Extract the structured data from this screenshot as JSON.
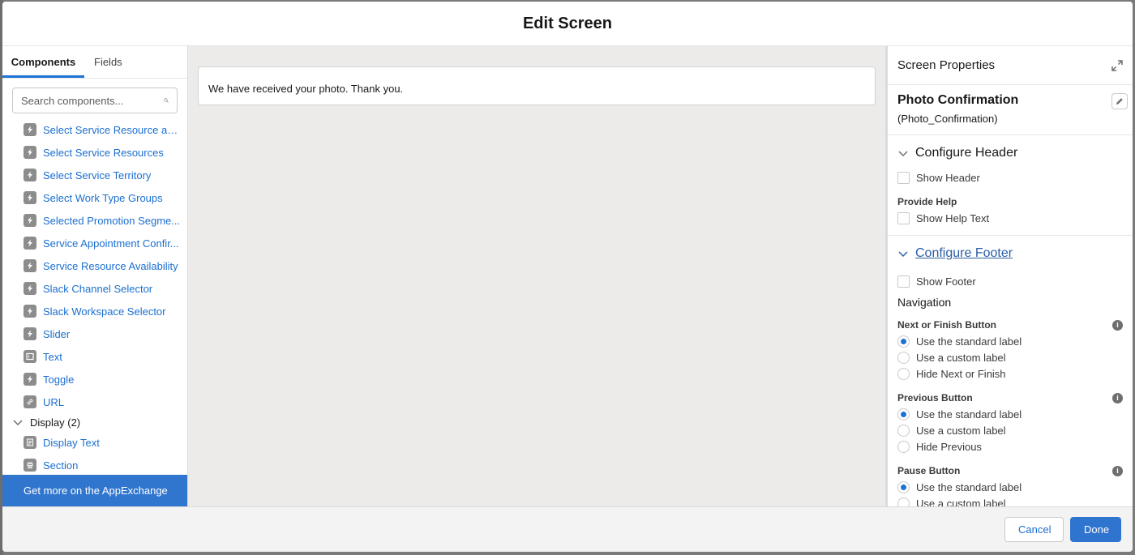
{
  "modal": {
    "title": "Edit Screen"
  },
  "left_panel": {
    "tabs": [
      {
        "label": "Components",
        "active": true
      },
      {
        "label": "Fields",
        "active": false
      }
    ],
    "search": {
      "placeholder": "Search components...",
      "value": ""
    },
    "components": [
      {
        "label": "Select Service Resource an...",
        "icon": "lightning-icon"
      },
      {
        "label": "Select Service Resources",
        "icon": "lightning-icon"
      },
      {
        "label": "Select Service Territory",
        "icon": "lightning-icon"
      },
      {
        "label": "Select Work Type Groups",
        "icon": "lightning-icon"
      },
      {
        "label": "Selected Promotion Segme...",
        "icon": "lightning-icon"
      },
      {
        "label": "Service Appointment Confir...",
        "icon": "lightning-icon"
      },
      {
        "label": "Service Resource Availability",
        "icon": "lightning-icon"
      },
      {
        "label": "Slack Channel Selector",
        "icon": "lightning-icon"
      },
      {
        "label": "Slack Workspace Selector",
        "icon": "lightning-icon"
      },
      {
        "label": "Slider",
        "icon": "lightning-icon"
      },
      {
        "label": "Text",
        "icon": "text-input-icon"
      },
      {
        "label": "Toggle",
        "icon": "lightning-icon"
      },
      {
        "label": "URL",
        "icon": "link-icon"
      }
    ],
    "display_section": {
      "label": "Display (2)",
      "items": [
        {
          "label": "Display Text",
          "icon": "display-text-icon"
        },
        {
          "label": "Section",
          "icon": "section-icon"
        }
      ]
    },
    "appexchange_label": "Get more on the AppExchange"
  },
  "canvas": {
    "display_text": "We have received your photo. Thank you."
  },
  "right_panel": {
    "title": "Screen Properties",
    "screen_label": "Photo Confirmation",
    "screen_api_name": "(Photo_Confirmation)",
    "configure_header": {
      "title": "Configure Header",
      "show_header": {
        "label": "Show Header",
        "checked": false
      },
      "provide_help_label": "Provide Help",
      "show_help_text": {
        "label": "Show Help Text",
        "checked": false
      }
    },
    "configure_footer": {
      "title": "Configure Footer",
      "show_footer": {
        "label": "Show Footer",
        "checked": false
      },
      "navigation_label": "Navigation",
      "groups": [
        {
          "label": "Next or Finish Button",
          "options": [
            "Use the standard label",
            "Use a custom label",
            "Hide Next or Finish"
          ],
          "selected": 0
        },
        {
          "label": "Previous Button",
          "options": [
            "Use the standard label",
            "Use a custom label",
            "Hide Previous"
          ],
          "selected": 0
        },
        {
          "label": "Pause Button",
          "options": [
            "Use the standard label",
            "Use a custom label"
          ],
          "selected": 0
        }
      ]
    }
  },
  "footer": {
    "cancel_label": "Cancel",
    "done_label": "Done"
  },
  "colors": {
    "brand": "#2f74cf",
    "link": "#1b6fd0",
    "canvas_bg": "#ecebea"
  }
}
